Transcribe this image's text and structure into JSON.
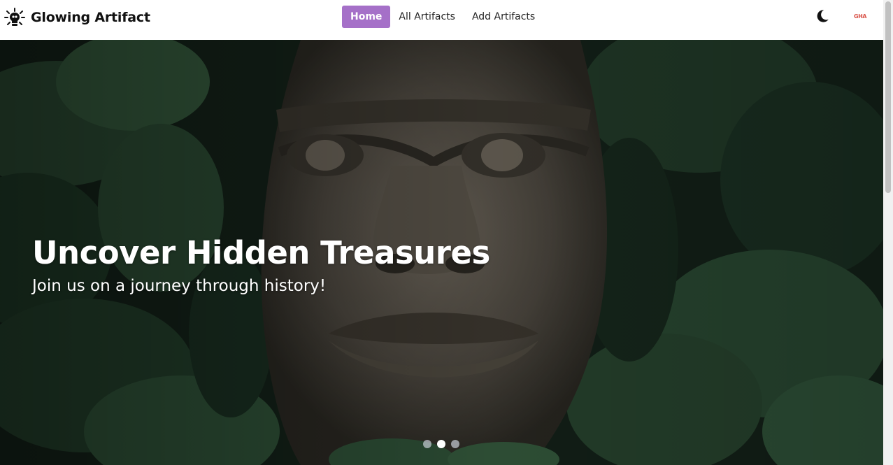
{
  "brand": {
    "name": "Glowing Artifact",
    "logo_icon": "glowing-bulb-icon"
  },
  "nav": {
    "links": [
      {
        "label": "Home",
        "active": true
      },
      {
        "label": "All Artifacts",
        "active": false
      },
      {
        "label": "Add Artifacts",
        "active": false
      }
    ],
    "active_color": "#a570c8"
  },
  "header_right": {
    "theme_toggle_icon": "moon-icon",
    "avatar_text": "GHA"
  },
  "hero": {
    "title": "Uncover Hidden Treasures",
    "subtitle": "Join us on a journey through history!",
    "slides": {
      "count": 3,
      "active_index": 1
    }
  }
}
